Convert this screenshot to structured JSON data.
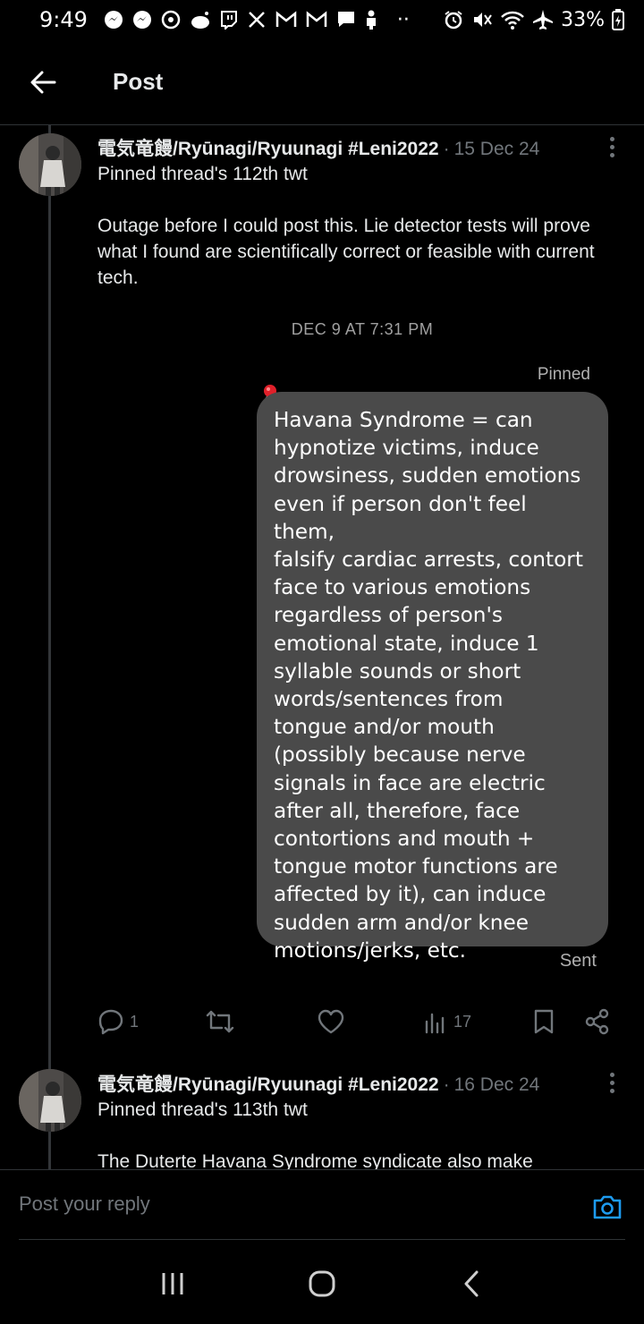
{
  "status_bar": {
    "time": "9:49",
    "left_icons": [
      "messenger-icon",
      "messenger-icon",
      "threads-icon",
      "reddit-icon",
      "twitch-icon",
      "x-icon",
      "gmail-icon",
      "gmail-icon",
      "chat-icon",
      "person-icon"
    ],
    "more": "··",
    "right_icons": [
      "alarm-icon",
      "mute-icon",
      "wifi-icon",
      "airplane-icon"
    ],
    "battery": "33%"
  },
  "header": {
    "title": "Post"
  },
  "tweets": [
    {
      "name": "電気竜饅/Ryūnagi/Ryuunagi #Leni2022",
      "separator": "·",
      "date": "15 Dec 24",
      "line1": "Pinned thread's 112th twt",
      "body": "Outage before I could post this. Lie detector tests will prove what I found are scientifically correct or feasible with current tech.",
      "screenshot": {
        "date": "DEC 9 AT 7:31 PM",
        "pinned_label": "Pinned",
        "message": "Havana Syndrome = can\nhypnotize victims, induce\ndrowsiness, sudden emotions\neven if person don't feel them,\nfalsify cardiac arrests, contort\nface to various emotions\nregardless of person's\nemotional state, induce 1\nsyllable sounds or short\nwords/sentences from\ntongue and/or mouth\n(possibly because nerve\nsignals in face are electric\nafter all, therefore, face\ncontortions and mouth +\ntongue motor functions are\naffected by it), can induce\nsudden arm and/or knee\nmotions/jerks, etc.",
        "sent_label": "Sent"
      },
      "actions": {
        "replies": "1",
        "reposts": "",
        "likes": "",
        "views": "17"
      }
    },
    {
      "name": "電気竜饅/Ryūnagi/Ryuunagi #Leni2022",
      "separator": "·",
      "date": "16 Dec 24",
      "line1": "Pinned thread's 113th twt",
      "body": "The Duterte Havana Syndrome syndicate also make"
    }
  ],
  "reply": {
    "placeholder": "Post your reply"
  },
  "colors": {
    "background": "#000000",
    "text": "#e7e9ea",
    "muted": "#71767b",
    "accent": "#1d9bf0",
    "bubble": "#4a4a4a"
  }
}
